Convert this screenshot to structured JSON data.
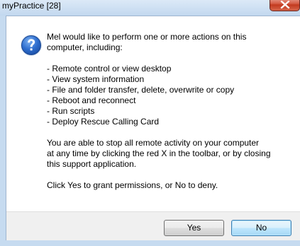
{
  "window": {
    "title": "myPractice [28]",
    "close_icon": "close-x-icon"
  },
  "dialog": {
    "icon": "question-icon",
    "intro": "Mel would like to perform one or more actions on this computer, including:",
    "intro_line1": "Mel would like to perform one or more actions on this",
    "intro_line2": "computer, including:",
    "actions": [
      "- Remote control or view desktop",
      "- View system information",
      "- File and folder transfer, delete, overwrite or copy",
      "- Reboot and reconnect",
      "- Run scripts",
      "- Deploy Rescue Calling Card"
    ],
    "notice_line1": "You are able to stop all remote activity on your computer",
    "notice_line2": "at any time by clicking the red X in the toolbar, or by closing",
    "notice_line3": "this support application.",
    "instruction": "Click Yes to grant permissions, or No to deny."
  },
  "buttons": {
    "yes_label": "Yes",
    "no_label": "No"
  },
  "colors": {
    "frame": "#c6dbf0",
    "close_button": "#c23a1f",
    "default_button_border": "#3c7fb1"
  }
}
